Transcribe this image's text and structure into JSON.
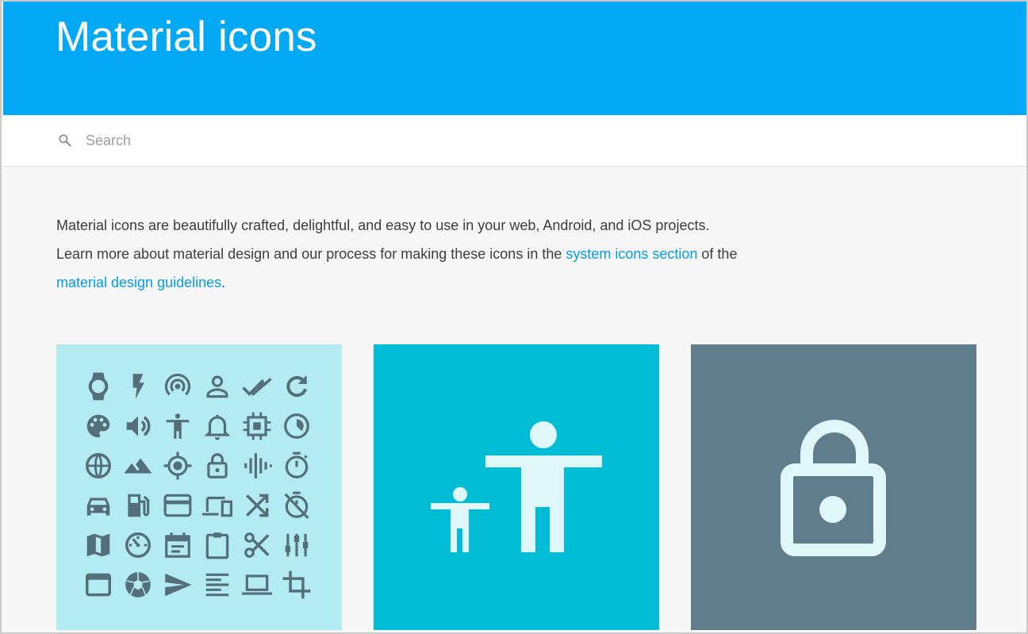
{
  "header": {
    "title": "Material icons"
  },
  "search": {
    "placeholder": "Search",
    "value": ""
  },
  "intro": {
    "line1": "Material icons are beautifully crafted, delightful, and easy to use in your web, Android, and iOS projects.",
    "line2_prefix": "Learn more about material design and our process for making these icons in the ",
    "link1": "system icons section",
    "line2_suffix": " of the",
    "link2": "material design guidelines",
    "line3_suffix": "."
  },
  "colors": {
    "header": "#03a9f4",
    "link": "#039be5",
    "card1": "#b2ebf2",
    "card2": "#00bcd4",
    "card3": "#607d8b",
    "icon_dark": "#546e7a",
    "icon_light": "#e0f7fa"
  },
  "cards": [
    {
      "name": "icon-grid-card",
      "icons": [
        "watch-icon",
        "flash-icon",
        "wifi-tethering-icon",
        "person-outline-icon",
        "done-all-icon",
        "refresh-icon",
        "palette-icon",
        "volume-up-icon",
        "accessibility-icon",
        "notifications-none-icon",
        "memory-icon",
        "timelapse-icon",
        "public-icon",
        "terrain-icon",
        "gps-fixed-icon",
        "lock-outline-icon",
        "graphic-eq-icon",
        "timer-icon",
        "directions-car-icon",
        "local-gas-station-icon",
        "credit-card-icon",
        "devices-icon",
        "shuffle-icon",
        "timer-off-icon",
        "map-icon",
        "av-timer-icon",
        "event-note-icon",
        "assignment-icon",
        "content-cut-icon",
        "tune-icon",
        "web-asset-icon",
        "camera-icon",
        "send-icon",
        "format-align-left-icon",
        "laptop-icon",
        "crop-icon"
      ]
    },
    {
      "name": "accessibility-card",
      "icon": "people-accessibility-icon"
    },
    {
      "name": "lock-open-card",
      "icon": "lock-open-icon"
    }
  ]
}
